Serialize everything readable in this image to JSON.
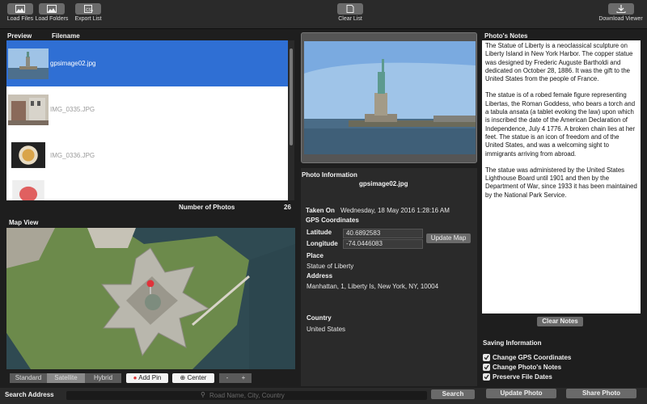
{
  "toolbar": {
    "load_files": "Load Files",
    "load_folders": "Load Folders",
    "export_list": "Export List",
    "clear_list": "Clear List",
    "download_viewer": "Download Viewer"
  },
  "list": {
    "col_preview": "Preview",
    "col_filename": "Filename",
    "rows": [
      {
        "filename": "gpsimage02.jpg",
        "selected": true
      },
      {
        "filename": "IMG_0335.JPG",
        "selected": false
      },
      {
        "filename": "IMG_0336.JPG",
        "selected": false
      },
      {
        "filename": "",
        "selected": false
      }
    ],
    "count_label": "Number of Photos",
    "count_value": "26"
  },
  "map": {
    "title": "Map View",
    "modes": [
      "Standard",
      "Satellite",
      "Hybrid"
    ],
    "selected_mode": "Satellite",
    "add_pin": "Add Pin",
    "center": "Center",
    "zoom_out": "-",
    "zoom_in": "+"
  },
  "info": {
    "title": "Photo Information",
    "filename": "gpsimage02.jpg",
    "taken_on_label": "Taken On",
    "taken_on_value": "Wednesday, 18 May 2016 1:28:16 AM",
    "gps_label": "GPS Coordinates",
    "lat_label": "Latitude",
    "lat_value": "40.6892583",
    "lon_label": "Longitude",
    "lon_value": "-74.0446083",
    "update_map": "Update Map",
    "place_label": "Place",
    "place_value": "Statue of Liberty",
    "address_label": "Address",
    "address_value": "Manhattan, 1, Liberty Is, New York, NY, 10004",
    "country_label": "Country",
    "country_value": "United States"
  },
  "notes": {
    "title": "Photo's Notes",
    "p1": "The Statue of Liberty is a neoclassical sculpture on Liberty Island in New York Harbor. The copper statue was designed by Frederic Auguste Bartholdi and dedicated on October 28, 1886. It was the gift to the United States from the people of France.",
    "p2": "The statue is of a robed female figure representing Libertas, the Roman Goddess, who bears a torch and a tabula ansata (a tablet evoking the law) upon which is inscribed the date of the American Declaration of Independence, July 4 1776. A broken chain lies at her feet. The statue is an icon of freedom and of the United States, and was a welcoming sight to immigrants arriving from abroad.",
    "p3": "The statue was administered by the United States Lighthouse Board until 1901 and then by the Department of War, since 1933 it has been maintained by the National Park Service.",
    "clear_notes": "Clear Notes"
  },
  "saving": {
    "title": "Saving Information",
    "opt1": "Change GPS Coordinates",
    "opt2": "Change Photo's Notes",
    "opt3": "Preserve File Dates",
    "update_photo": "Update Photo",
    "share_photo": "Share Photo"
  },
  "search": {
    "label": "Search Address",
    "placeholder": "Road Name, City, Country",
    "button": "Search"
  },
  "colors": {
    "selection": "#2f6fd4",
    "water": "#2f4a52",
    "grass": "#6c8a4b"
  }
}
